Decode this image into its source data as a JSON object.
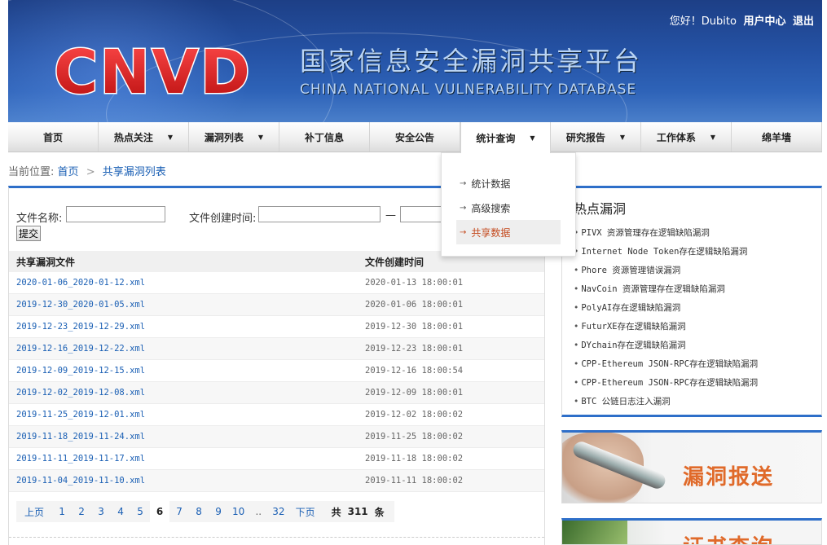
{
  "header": {
    "logo_text": "CNVD",
    "title": "国家信息安全漏洞共享平台",
    "subtitle": "CHINA NATIONAL VULNERABILITY DATABASE",
    "greeting": "您好！Dubito",
    "user_center": "用户中心",
    "logout": "退出"
  },
  "nav": {
    "items": [
      {
        "label": "首页",
        "caret": false
      },
      {
        "label": "热点关注",
        "caret": true
      },
      {
        "label": "漏洞列表",
        "caret": true
      },
      {
        "label": "补丁信息",
        "caret": false
      },
      {
        "label": "安全公告",
        "caret": false
      },
      {
        "label": "统计查询",
        "caret": true,
        "active": true
      },
      {
        "label": "研究报告",
        "caret": true
      },
      {
        "label": "工作体系",
        "caret": true
      },
      {
        "label": "绵羊墙",
        "caret": false
      }
    ],
    "caret_glyph": "▼"
  },
  "dropdown": {
    "items": [
      {
        "label": "统计数据"
      },
      {
        "label": "高级搜索"
      },
      {
        "label": "共享数据",
        "active": true
      }
    ],
    "arrow_glyph": "→"
  },
  "breadcrumb": {
    "prefix": "当前位置:",
    "home": "首页",
    "sep": ">",
    "current": "共享漏洞列表"
  },
  "filter": {
    "file_name_label": "文件名称:",
    "file_name_value": "",
    "created_label": "文件创建时间:",
    "created_from": "",
    "dash": "—",
    "created_to": "",
    "submit_label": "提交"
  },
  "table": {
    "headers": [
      "共享漏洞文件",
      "文件创建时间"
    ],
    "rows": [
      [
        "2020-01-06_2020-01-12.xml",
        "2020-01-13 18:00:01"
      ],
      [
        "2019-12-30_2020-01-05.xml",
        "2020-01-06 18:00:01"
      ],
      [
        "2019-12-23_2019-12-29.xml",
        "2019-12-30 18:00:01"
      ],
      [
        "2019-12-16_2019-12-22.xml",
        "2019-12-23 18:00:01"
      ],
      [
        "2019-12-09_2019-12-15.xml",
        "2019-12-16 18:00:54"
      ],
      [
        "2019-12-02_2019-12-08.xml",
        "2019-12-09 18:00:01"
      ],
      [
        "2019-11-25_2019-12-01.xml",
        "2019-12-02 18:00:02"
      ],
      [
        "2019-11-18_2019-11-24.xml",
        "2019-11-25 18:00:02"
      ],
      [
        "2019-11-11_2019-11-17.xml",
        "2019-11-18 18:00:02"
      ],
      [
        "2019-11-04_2019-11-10.xml",
        "2019-11-11 18:00:02"
      ]
    ]
  },
  "pager": {
    "prev": "上页",
    "pages": [
      "1",
      "2",
      "3",
      "4",
      "5",
      "6",
      "7",
      "8",
      "9",
      "10",
      "..",
      "32"
    ],
    "current": "6",
    "next": "下页",
    "total_prefix": "共",
    "total": "311",
    "total_suffix": "条"
  },
  "sidebar": {
    "hot_title": "热点漏洞",
    "hot_items": [
      "PIVX 资源管理存在逻辑缺陷漏洞",
      "Internet Node Token存在逻辑缺陷漏洞",
      "Phore 资源管理错误漏洞",
      "NavCoin 资源管理存在逻辑缺陷漏洞",
      "PolyAI存在逻辑缺陷漏洞",
      "FuturXE存在逻辑缺陷漏洞",
      "DYchain存在逻辑缺陷漏洞",
      "CPP-Ethereum JSON-RPC存在逻辑缺陷漏洞",
      "CPP-Ethereum JSON-RPC存在逻辑缺陷漏洞",
      "BTC 公链日志注入漏洞"
    ],
    "banner1": "漏洞报送",
    "banner2": "证书查询"
  },
  "colors": {
    "header_blue": "#2553a6",
    "logo_red": "#e01a1a",
    "link_blue": "#1a5fb4",
    "accent_blue": "#2e6fc9",
    "active_orange": "#c44a1e",
    "banner_orange": "#e06a2a"
  }
}
